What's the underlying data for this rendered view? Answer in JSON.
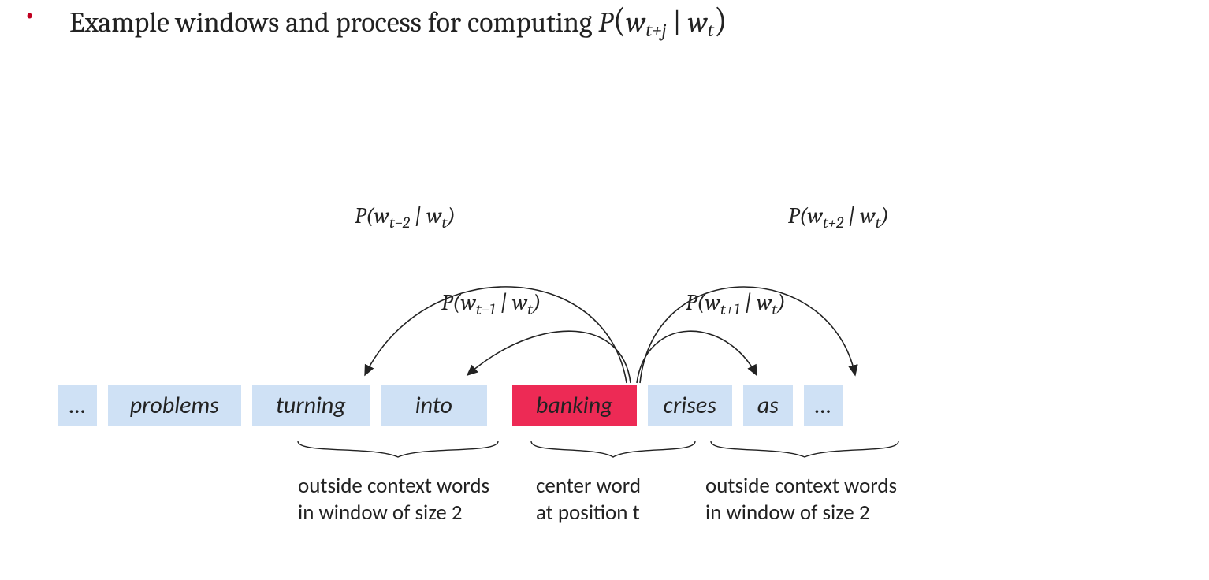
{
  "bullet": "•",
  "heading": {
    "text": "Example windows and process for computing ",
    "P": "P",
    "open": "(",
    "w": "w",
    "sub_tj": "t+j",
    "bar": " | ",
    "sub_t": "t",
    "close": ")"
  },
  "words": {
    "dots_l": "…",
    "problems": "problems",
    "turning": "turning",
    "into": "into",
    "banking": "banking",
    "crises": "crises",
    "as": "as",
    "dots_r": "…"
  },
  "prob": {
    "P": "P",
    "open": "(",
    "w": "w",
    "bar": " | ",
    "close": ")",
    "s_tm2": "t−2",
    "s_tm1": "t−1",
    "s_tp1": "t+1",
    "s_tp2": "t+2",
    "s_t": "t"
  },
  "labels": {
    "left1": "outside context words",
    "left2": "in window of size 2",
    "center1": "center word",
    "center2": "at position t",
    "right1": "outside context words",
    "right2": "in window of size 2"
  }
}
